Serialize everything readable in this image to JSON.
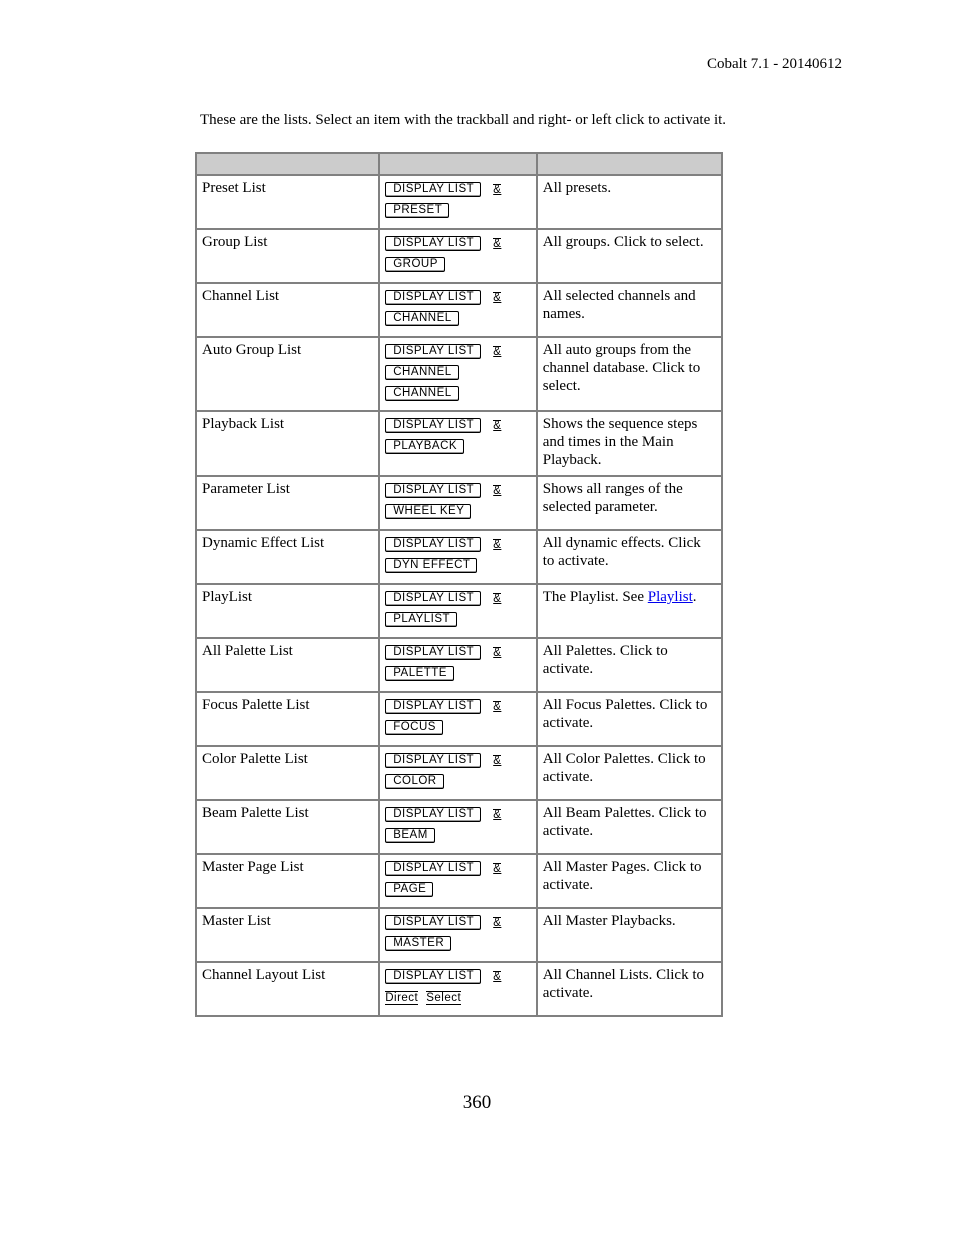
{
  "header": {
    "version_label": "Cobalt 7.1 - 20140612"
  },
  "intro": "These are the lists. Select an item with the trackball and right- or left click to activate it.",
  "table": {
    "headers": [
      "",
      "",
      ""
    ],
    "rows": [
      {
        "name": "Preset List",
        "keys": [
          [
            "DISPLAY LIST",
            "&"
          ],
          [
            "PRESET"
          ]
        ],
        "desc": "All presets."
      },
      {
        "name": "Group List",
        "keys": [
          [
            "DISPLAY LIST",
            "&"
          ],
          [
            "GROUP"
          ]
        ],
        "desc": "All groups. Click to select."
      },
      {
        "name": "Channel List",
        "keys": [
          [
            "DISPLAY LIST",
            "&"
          ],
          [
            "CHANNEL"
          ]
        ],
        "desc": "All selected channels and names."
      },
      {
        "name": "Auto Group List",
        "keys": [
          [
            "DISPLAY LIST",
            "&"
          ],
          [
            "CHANNEL"
          ],
          [
            "CHANNEL"
          ]
        ],
        "desc": "All auto groups from the channel database. Click to select."
      },
      {
        "name": "Playback List",
        "keys": [
          [
            "DISPLAY LIST",
            "&"
          ],
          [
            "PLAYBACK"
          ]
        ],
        "desc": "Shows the sequence steps and times in the Main Playback."
      },
      {
        "name": "Parameter List",
        "keys": [
          [
            "DISPLAY LIST",
            "&"
          ],
          [
            "WHEEL KEY"
          ]
        ],
        "desc": "Shows all ranges of the selected parameter."
      },
      {
        "name": "Dynamic Effect List",
        "keys": [
          [
            "DISPLAY LIST",
            "&"
          ],
          [
            "DYN EFFECT"
          ]
        ],
        "desc": "All dynamic effects. Click to activate."
      },
      {
        "name": "PlayList",
        "keys": [
          [
            "DISPLAY LIST",
            "&"
          ],
          [
            "PLAYLIST"
          ]
        ],
        "desc_prefix": "The Playlist. See ",
        "desc_link": "Playlist",
        "desc_suffix": "."
      },
      {
        "name": "All Palette List",
        "keys": [
          [
            "DISPLAY LIST",
            "&"
          ],
          [
            "PALETTE"
          ]
        ],
        "desc": "All Palettes. Click to activate."
      },
      {
        "name": "Focus Palette List",
        "keys": [
          [
            "DISPLAY LIST",
            "&"
          ],
          [
            "FOCUS"
          ]
        ],
        "desc": "All Focus Palettes. Click to activate."
      },
      {
        "name": "Color Palette List",
        "keys": [
          [
            "DISPLAY LIST",
            "&"
          ],
          [
            "COLOR"
          ]
        ],
        "desc": "All Color Palettes. Click to activate."
      },
      {
        "name": "Beam Palette List",
        "keys": [
          [
            "DISPLAY LIST",
            "&"
          ],
          [
            "BEAM"
          ]
        ],
        "desc": "All Beam Palettes. Click to activate."
      },
      {
        "name": "Master Page List",
        "keys": [
          [
            "DISPLAY LIST",
            "&"
          ],
          [
            "PAGE"
          ]
        ],
        "desc": "All Master Pages. Click to activate."
      },
      {
        "name": "Master List",
        "keys": [
          [
            "DISPLAY LIST",
            "&"
          ],
          [
            "MASTER"
          ]
        ],
        "desc": "All Master Playbacks."
      },
      {
        "name": "Channel Layout List",
        "keys": [
          [
            "DISPLAY LIST",
            "&"
          ]
        ],
        "softkeys": [
          "Direct",
          "Select"
        ],
        "desc": "All Channel Lists. Click to activate."
      }
    ]
  },
  "footer": {
    "page_number": "360"
  }
}
